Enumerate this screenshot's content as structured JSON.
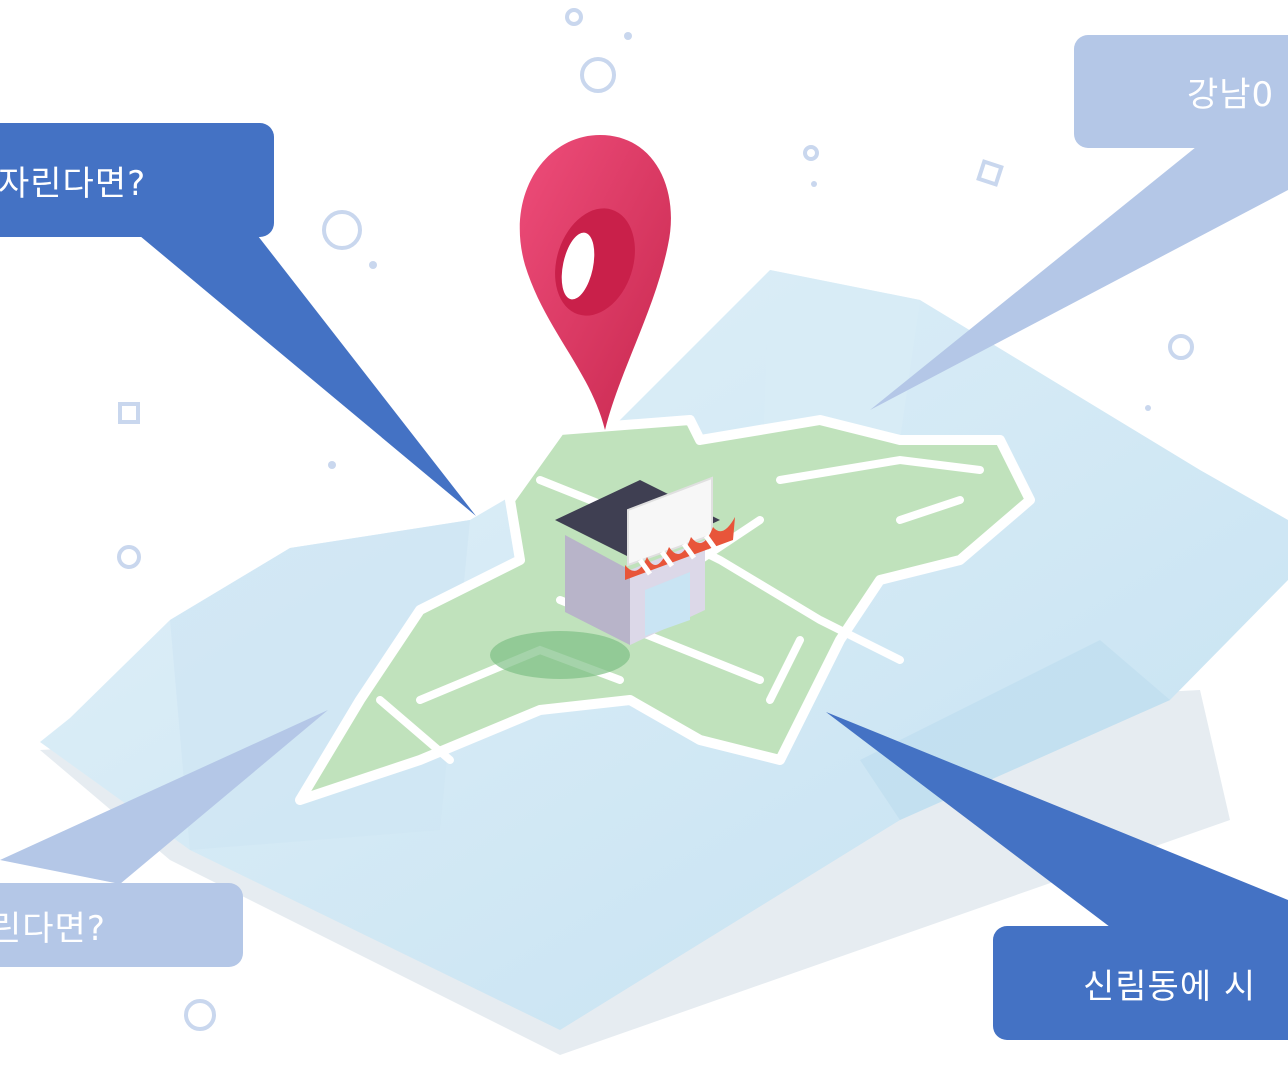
{
  "bubbles": {
    "top_left": "자린다면?",
    "top_right": "강남0",
    "bottom_left": "린다면?",
    "bottom_right": "신림동에 시"
  },
  "colors": {
    "bubble_dark": "#4472c4",
    "bubble_light": "#b4c7e7",
    "map_water": "#d3e9f5",
    "map_land": "#b8deb4",
    "pin": "#e33d6b",
    "awning": "#e8553a"
  },
  "icons": [
    "map-pin-icon",
    "store-icon",
    "folded-map-icon"
  ]
}
